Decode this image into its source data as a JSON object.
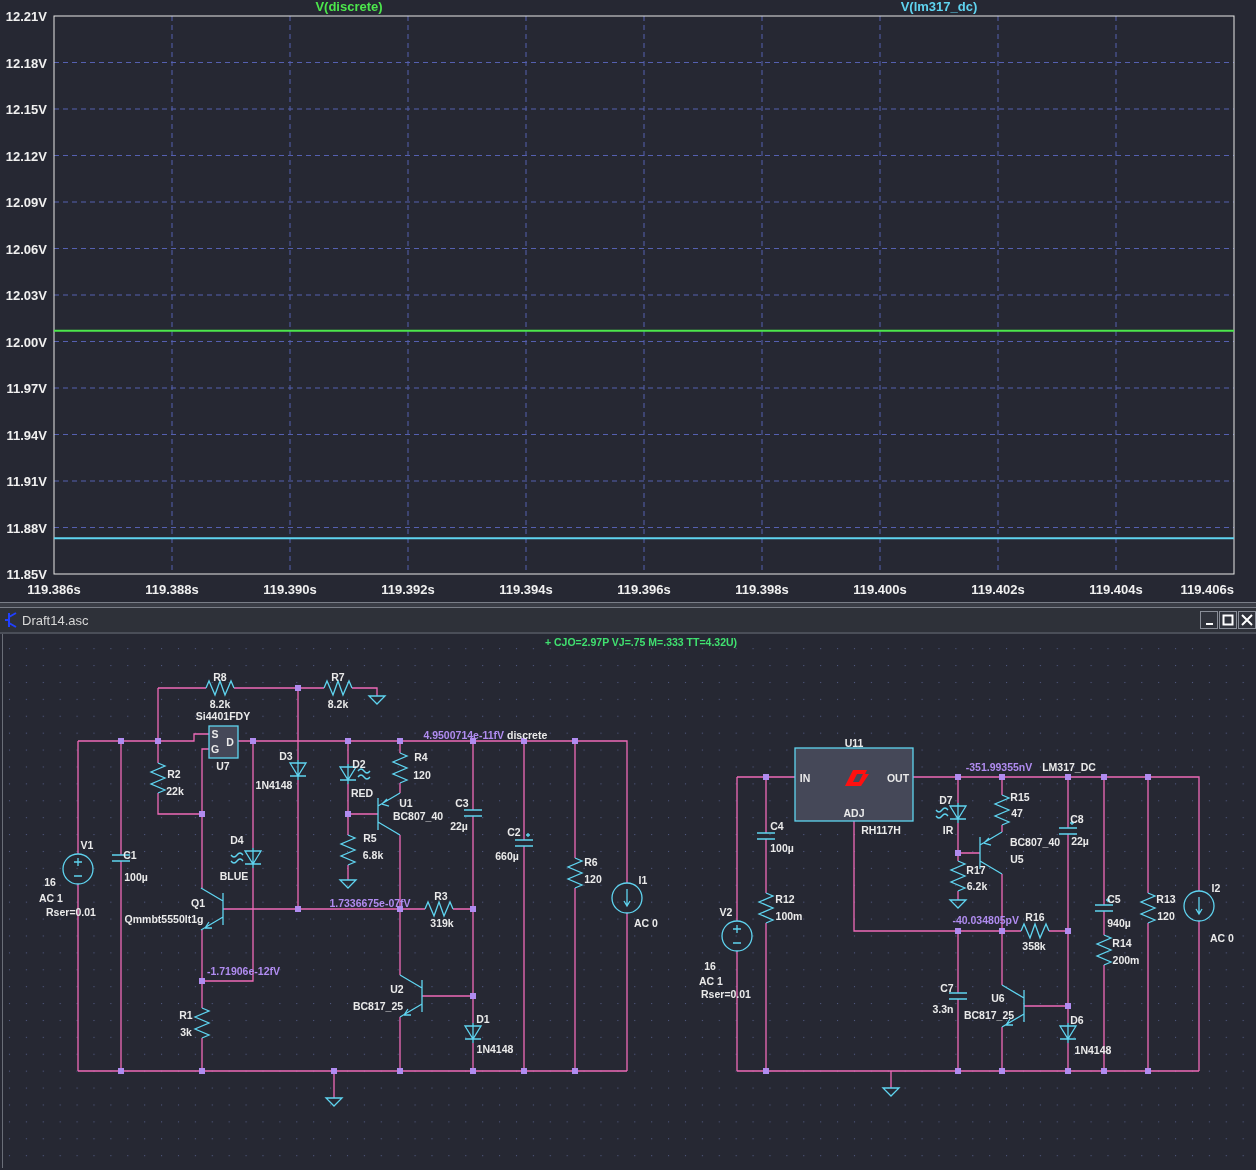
{
  "plot": {
    "chart_data": {
      "type": "line",
      "grid": true,
      "x": [
        119.386,
        119.406
      ],
      "xlim": [
        119.386,
        119.406
      ],
      "ylim": [
        11.85,
        12.21
      ],
      "xticks": [
        {
          "value": 119.386,
          "label": "119.386s"
        },
        {
          "value": 119.388,
          "label": "119.388s"
        },
        {
          "value": 119.39,
          "label": "119.390s"
        },
        {
          "value": 119.392,
          "label": "119.392s"
        },
        {
          "value": 119.394,
          "label": "119.394s"
        },
        {
          "value": 119.396,
          "label": "119.396s"
        },
        {
          "value": 119.398,
          "label": "119.398s"
        },
        {
          "value": 119.4,
          "label": "119.400s"
        },
        {
          "value": 119.402,
          "label": "119.402s"
        },
        {
          "value": 119.404,
          "label": "119.404s"
        },
        {
          "value": 119.406,
          "label": "119.406s"
        }
      ],
      "yticks": [
        {
          "value": 12.21,
          "label": "12.21V"
        },
        {
          "value": 12.18,
          "label": "12.18V"
        },
        {
          "value": 12.15,
          "label": "12.15V"
        },
        {
          "value": 12.12,
          "label": "12.12V"
        },
        {
          "value": 12.09,
          "label": "12.09V"
        },
        {
          "value": 12.06,
          "label": "12.06V"
        },
        {
          "value": 12.03,
          "label": "12.03V"
        },
        {
          "value": 12.0,
          "label": "12.00V"
        },
        {
          "value": 11.97,
          "label": "11.97V"
        },
        {
          "value": 11.94,
          "label": "11.94V"
        },
        {
          "value": 11.91,
          "label": "11.91V"
        },
        {
          "value": 11.88,
          "label": "11.88V"
        },
        {
          "value": 11.85,
          "label": "11.85V"
        }
      ],
      "series": [
        {
          "name": "V(discrete)",
          "color": "#4ce64c",
          "values": [
            12.007,
            12.007
          ]
        },
        {
          "name": "V(lm317_dc)",
          "color": "#5fd4f0",
          "values": [
            11.873,
            11.873
          ]
        }
      ]
    }
  },
  "schematic": {
    "title": "Draft14.asc",
    "spice_line": "+ CJO=2.97P VJ=.75 M=.333 TT=4.32U)",
    "labels": [
      {
        "text": "R8",
        "kind": "ref"
      },
      {
        "text": "8.2k",
        "kind": "value"
      },
      {
        "text": "R7",
        "kind": "ref"
      },
      {
        "text": "8.2k",
        "kind": "value"
      },
      {
        "text": "Si4401FDY",
        "kind": "value"
      },
      {
        "text": "S",
        "kind": "pin"
      },
      {
        "text": "4.9500714e-11fV",
        "kind": "voltage"
      },
      {
        "text": "discrete",
        "kind": "net"
      },
      {
        "text": "D",
        "kind": "pin"
      },
      {
        "text": "G",
        "kind": "pin"
      },
      {
        "text": "U7",
        "kind": "ref"
      },
      {
        "text": "R2",
        "kind": "ref"
      },
      {
        "text": "22k",
        "kind": "value"
      },
      {
        "text": "D3",
        "kind": "ref"
      },
      {
        "text": "1N4148",
        "kind": "value"
      },
      {
        "text": "D2",
        "kind": "ref"
      },
      {
        "text": "RED",
        "kind": "value"
      },
      {
        "text": "R4",
        "kind": "ref"
      },
      {
        "text": "120",
        "kind": "value"
      },
      {
        "text": "U1",
        "kind": "ref"
      },
      {
        "text": "BC807_40",
        "kind": "value"
      },
      {
        "text": "R5",
        "kind": "ref"
      },
      {
        "text": "6.8k",
        "kind": "value"
      },
      {
        "text": "V1",
        "kind": "ref"
      },
      {
        "text": "16",
        "kind": "value"
      },
      {
        "text": "AC 1",
        "kind": "value"
      },
      {
        "text": "Rser=0.01",
        "kind": "value"
      },
      {
        "text": "C1",
        "kind": "ref"
      },
      {
        "text": "100µ",
        "kind": "value"
      },
      {
        "text": "D4",
        "kind": "ref"
      },
      {
        "text": "BLUE",
        "kind": "value"
      },
      {
        "text": "Q1",
        "kind": "ref"
      },
      {
        "text": "Qmmbt5550lt1g",
        "kind": "value"
      },
      {
        "text": "1.7336675e-07fV",
        "kind": "voltage"
      },
      {
        "text": "R3",
        "kind": "ref"
      },
      {
        "text": "319k",
        "kind": "value"
      },
      {
        "text": "-1.71906e-12fV",
        "kind": "voltage"
      },
      {
        "text": "R1",
        "kind": "ref"
      },
      {
        "text": "3k",
        "kind": "value"
      },
      {
        "text": "U2",
        "kind": "ref"
      },
      {
        "text": "BC817_25",
        "kind": "value"
      },
      {
        "text": "D1",
        "kind": "ref"
      },
      {
        "text": "1N4148",
        "kind": "value"
      },
      {
        "text": "C3",
        "kind": "ref"
      },
      {
        "text": "22µ",
        "kind": "value"
      },
      {
        "text": "C2",
        "kind": "ref"
      },
      {
        "text": "660µ",
        "kind": "value"
      },
      {
        "text": "R6",
        "kind": "ref"
      },
      {
        "text": "120",
        "kind": "value"
      },
      {
        "text": "I1",
        "kind": "ref"
      },
      {
        "text": "AC 0",
        "kind": "value"
      },
      {
        "text": "U11",
        "kind": "ref"
      },
      {
        "text": "IN",
        "kind": "pin"
      },
      {
        "text": "OUT",
        "kind": "pin"
      },
      {
        "text": "ADJ",
        "kind": "pin"
      },
      {
        "text": "RH117H",
        "kind": "value"
      },
      {
        "text": "-351.99355nV",
        "kind": "voltage"
      },
      {
        "text": "LM317_DC",
        "kind": "net"
      },
      {
        "text": "D7",
        "kind": "ref"
      },
      {
        "text": "IR",
        "kind": "value"
      },
      {
        "text": "R15",
        "kind": "ref"
      },
      {
        "text": "47",
        "kind": "value"
      },
      {
        "text": "C8",
        "kind": "ref"
      },
      {
        "text": "BC807_40",
        "kind": "value"
      },
      {
        "text": "22µ",
        "kind": "value"
      },
      {
        "text": "U5",
        "kind": "ref"
      },
      {
        "text": "C4",
        "kind": "ref"
      },
      {
        "text": "100µ",
        "kind": "value"
      },
      {
        "text": "R17",
        "kind": "ref"
      },
      {
        "text": "6.2k",
        "kind": "value"
      },
      {
        "text": "R12",
        "kind": "ref"
      },
      {
        "text": "100m",
        "kind": "value"
      },
      {
        "text": "C5",
        "kind": "ref"
      },
      {
        "text": "940µ",
        "kind": "value"
      },
      {
        "text": "R13",
        "kind": "ref"
      },
      {
        "text": "120",
        "kind": "value"
      },
      {
        "text": "I2",
        "kind": "ref"
      },
      {
        "text": "AC 0",
        "kind": "value"
      },
      {
        "text": "V2",
        "kind": "ref"
      },
      {
        "text": "R16",
        "kind": "ref"
      },
      {
        "text": "358k",
        "kind": "value"
      },
      {
        "text": "-40.034805pV",
        "kind": "voltage"
      },
      {
        "text": "R14",
        "kind": "ref"
      },
      {
        "text": "200m",
        "kind": "value"
      },
      {
        "text": "16",
        "kind": "value"
      },
      {
        "text": "AC 1",
        "kind": "value"
      },
      {
        "text": "Rser=0.01",
        "kind": "value"
      },
      {
        "text": "C7",
        "kind": "ref"
      },
      {
        "text": "3.3n",
        "kind": "value"
      },
      {
        "text": "U6",
        "kind": "ref"
      },
      {
        "text": "BC817_25",
        "kind": "value"
      },
      {
        "text": "D6",
        "kind": "ref"
      },
      {
        "text": "1N4148",
        "kind": "value"
      }
    ]
  }
}
